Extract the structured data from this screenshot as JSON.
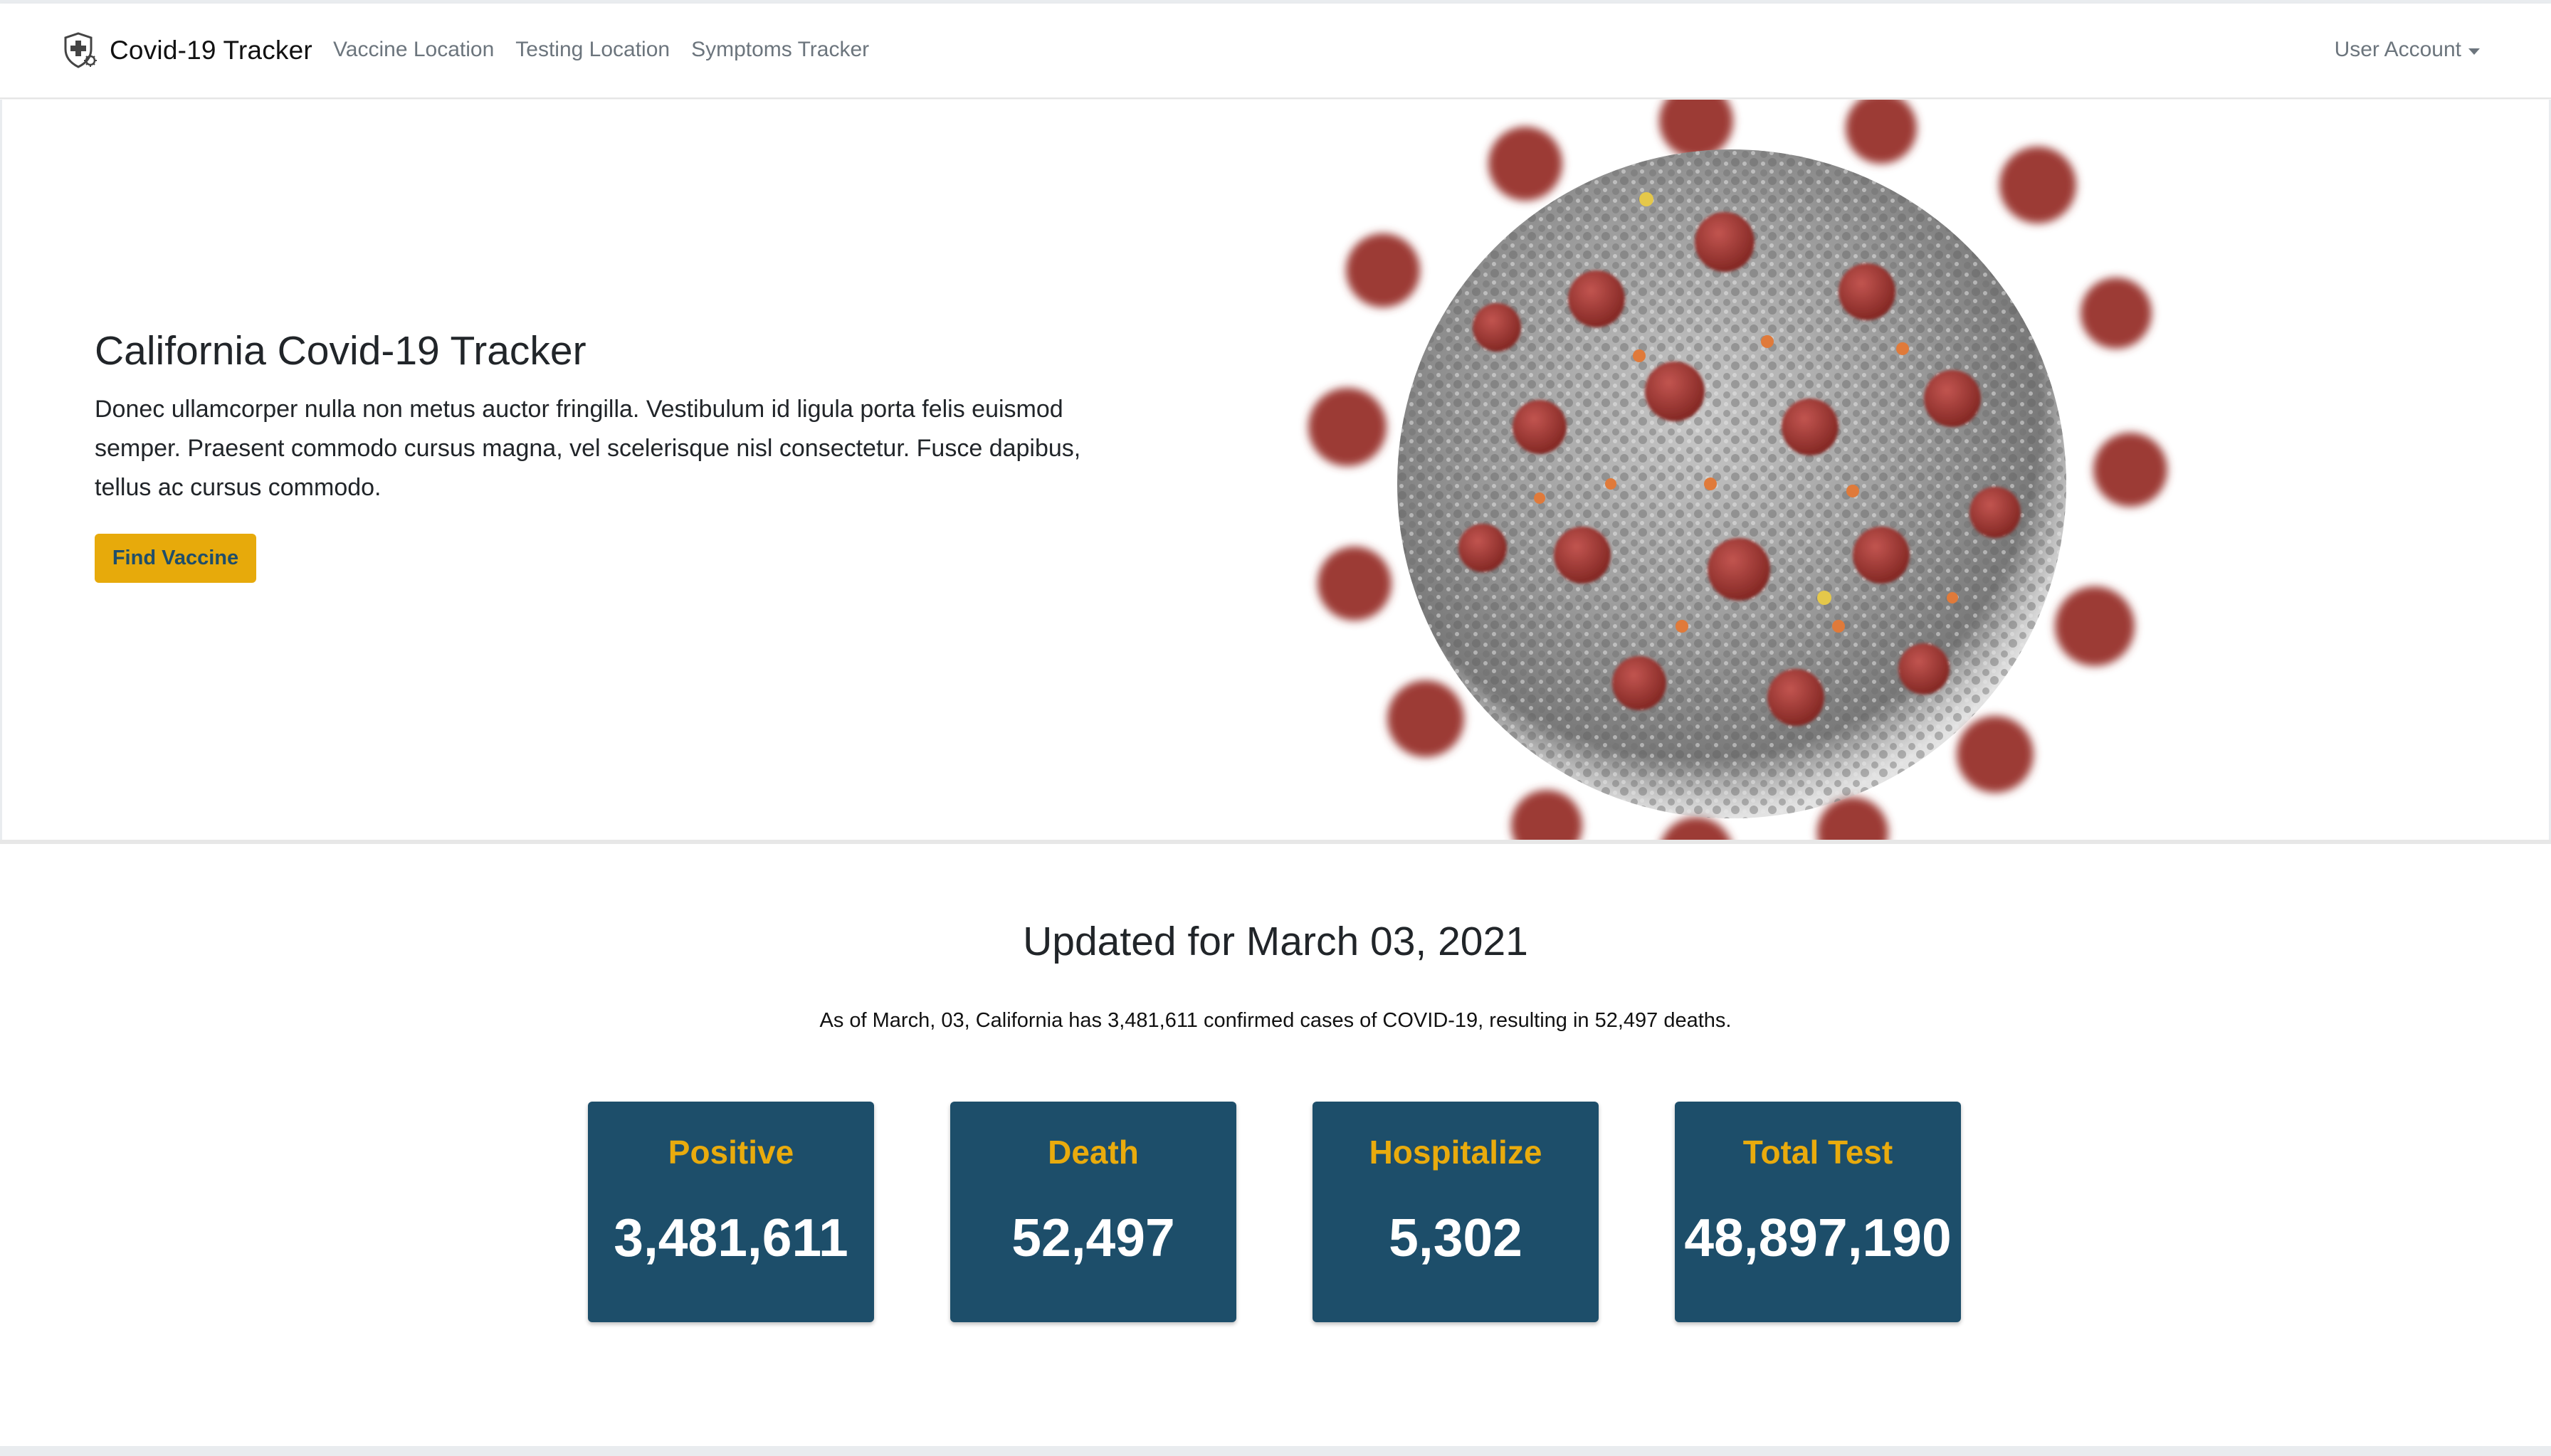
{
  "navbar": {
    "brand": "Covid-19 Tracker",
    "links": [
      "Vaccine Location",
      "Testing Location",
      "Symptoms Tracker"
    ],
    "user_account": "User Account"
  },
  "hero": {
    "title": "California Covid-19 Tracker",
    "text": "Donec ullamcorper nulla non metus auctor fringilla. Vestibulum id ligula porta felis euismod semper. Praesent commodo cursus magna, vel scelerisque nisl consectetur. Fusce dapibus, tellus ac cursus commodo.",
    "button": "Find Vaccine"
  },
  "stats": {
    "title": "Updated for March 03, 2021",
    "summary": "As of March, 03, California has 3,481,611 confirmed cases of COVID-19, resulting in 52,497 deaths.",
    "cards": [
      {
        "label": "Positive",
        "value": "3,481,611"
      },
      {
        "label": "Death",
        "value": "52,497"
      },
      {
        "label": "Hospitalize",
        "value": "5,302"
      },
      {
        "label": "Total Test",
        "value": "48,897,190"
      }
    ]
  },
  "colors": {
    "card_bg": "#1d4e6a",
    "accent": "#e9ab0d",
    "button_bg": "#e7aa0b"
  },
  "icons": {
    "brand": "shield-virus-icon",
    "user_account": "caret-down-icon"
  }
}
